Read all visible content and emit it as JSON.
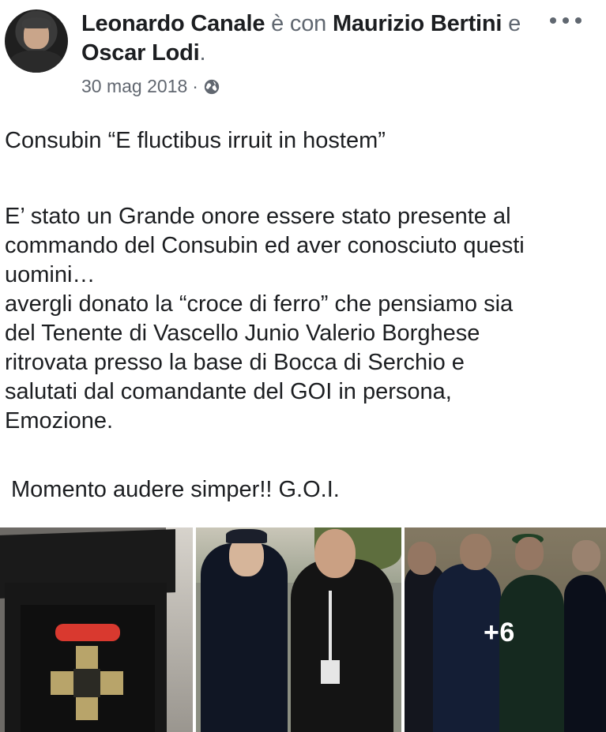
{
  "post": {
    "author": "Leonardo Canale",
    "with_word": "è con",
    "tagged_1": "Maurizio Bertini",
    "and_word": "e",
    "tagged_2": "Oscar Lodi",
    "end_punct": ".",
    "date": "30 mag 2018",
    "date_separator": "·",
    "privacy_icon": "globe-icon",
    "options_icon": "more-options-icon",
    "paragraphs": [
      "Consubin “E fluctibus irruit in hostem”",
      "E’ stato un Grande onore essere stato presente al\ncommando del Consubin ed aver conosciuto questi\nuomini…\navergli donato la “croce di ferro” che pensiamo sia\ndel Tenente di Vascello Junio Valerio Borghese\nritrovata presso la base di Bocca di Serchio e\nsalutati dal comandante del GOI in persona,\nEmozione.",
      "Momento audere simper!! G.O.I."
    ],
    "photos": {
      "more_count": "+6"
    }
  }
}
